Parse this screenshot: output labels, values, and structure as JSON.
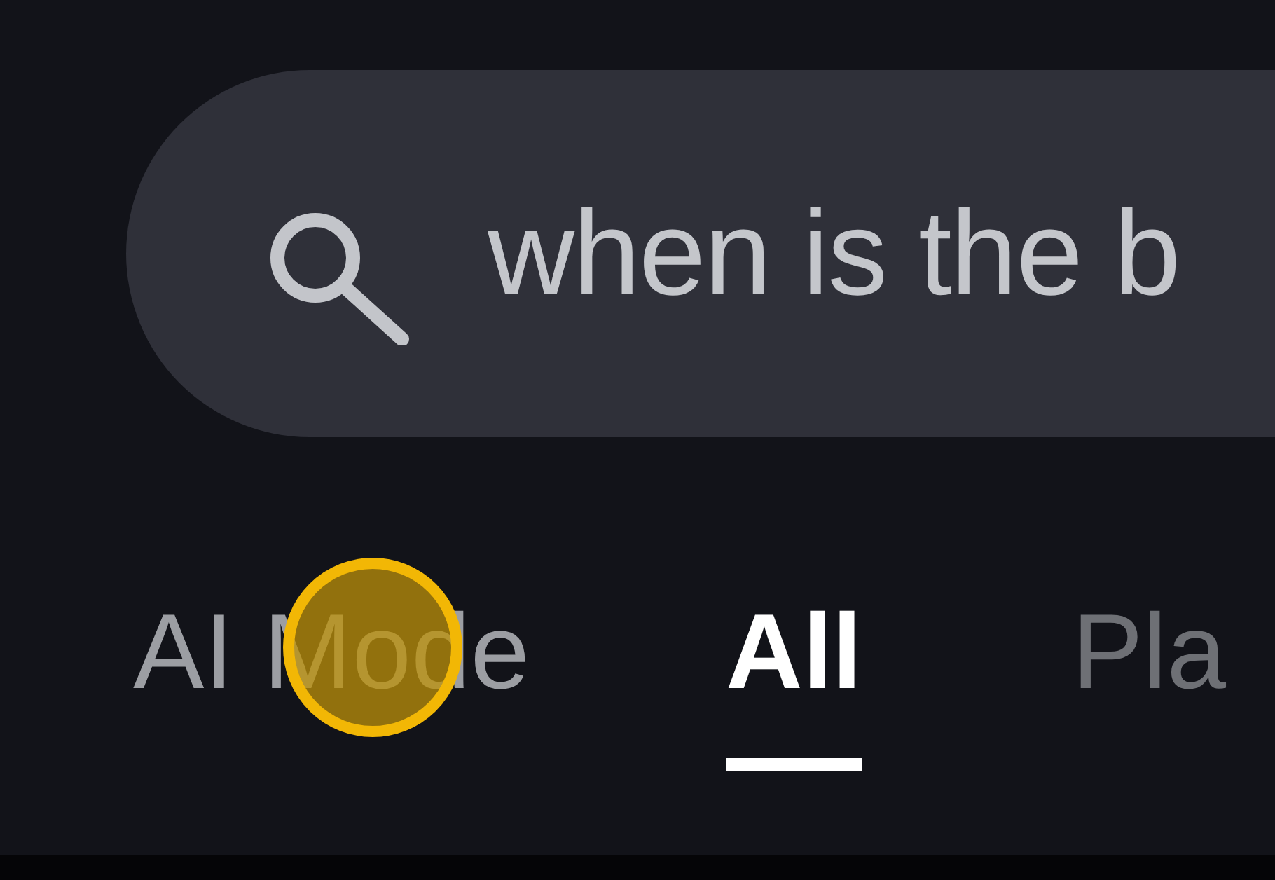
{
  "search": {
    "query": "when is the b"
  },
  "tabs": [
    {
      "label": "AI Mode",
      "selected": false
    },
    {
      "label": "All",
      "selected": true
    },
    {
      "label": "Pla",
      "selected": false
    }
  ]
}
